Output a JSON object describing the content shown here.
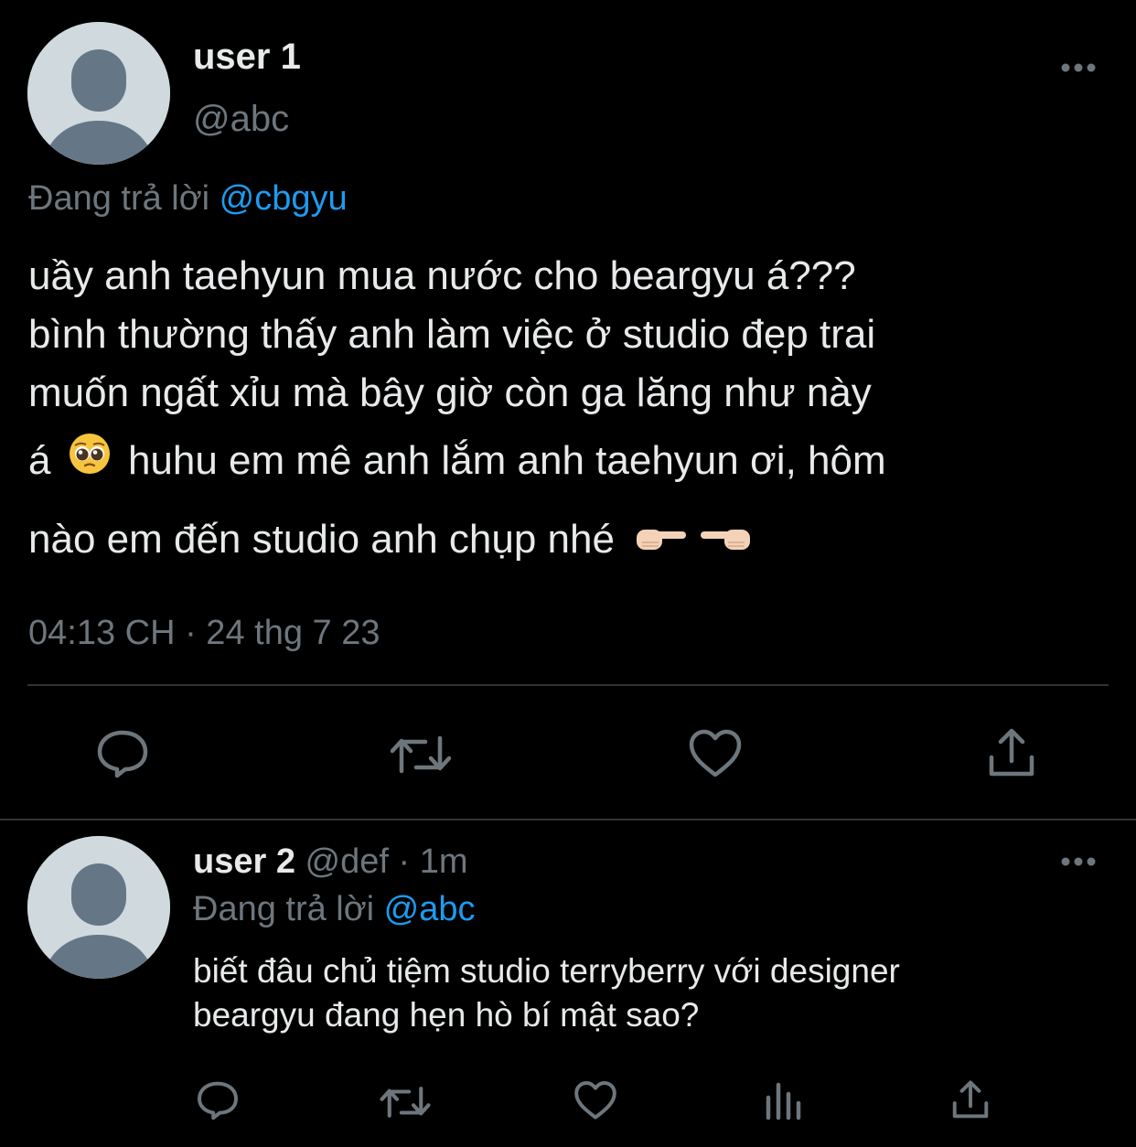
{
  "tweet": {
    "author_name": "user 1",
    "handle": "@abc",
    "replying_prefix": "Đang trả lời",
    "replying_to": "@cbgyu",
    "text_lines": [
      "uầy anh taehyun mua nước cho beargyu á???",
      "bình thường thấy anh làm việc ở studio đẹp trai",
      "muốn ngất xỉu mà bây giờ còn ga lăng như này",
      "huhu em mê anh lắm anh taehyun ơi, hôm",
      "nào em đến studio anh chụp nhé"
    ],
    "line4_start": "á",
    "timestamp": "04:13 CH · 24 thg 7 23",
    "more_icon": "more-horizontal-icon",
    "actions": [
      "reply-icon",
      "retweet-icon",
      "like-icon",
      "share-icon"
    ]
  },
  "reply": {
    "author_name": "user 2",
    "handle": "@def",
    "time": "· 1m",
    "replying_prefix": "Đang trả lời",
    "replying_to": "@abc",
    "text_lines": [
      "biết đâu chủ tiệm studio terryberry với designer",
      "beargyu đang hẹn hò bí mật sao?"
    ],
    "more_icon": "more-horizontal-icon",
    "actions": [
      "reply-icon",
      "retweet-icon",
      "like-icon",
      "analytics-icon",
      "share-icon"
    ]
  },
  "colors": {
    "background": "#000000",
    "text": "#e7e9ea",
    "muted": "#6e767d",
    "link": "#1d9bf0",
    "avatar_bg": "#cfd9de",
    "avatar_fg": "#657786",
    "divider": "#2f3336"
  }
}
